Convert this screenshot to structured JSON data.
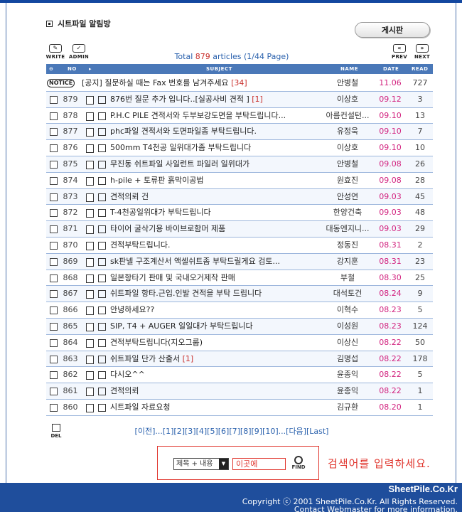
{
  "board": {
    "title": "시트파일 알림방",
    "tab_label": "게시판"
  },
  "toolbar": {
    "write": "WRITE",
    "admin": "ADMIN",
    "prev": "PREV",
    "next": "NEXT",
    "del": "DEL",
    "find": "FIND"
  },
  "total": {
    "prefix": "Total ",
    "count": "879",
    "suffix": " articles (1/44 Page)"
  },
  "columns": {
    "no": "NO",
    "subject": "SUBJECT",
    "name": "NAME",
    "date": "DATE",
    "read": "READ"
  },
  "notice": {
    "badge": "NOTICE",
    "subject": "[공지] 질문하실 때는 Fax 번호를 남겨주세요",
    "comments": "[34]",
    "name": "안병철",
    "date": "11.06",
    "read": "727"
  },
  "rows": [
    {
      "no": "879",
      "subject": "876번 질문 추가 입니다..[실공사비 견적 ]",
      "comments": "[1]",
      "name": "이상호",
      "date": "09.12",
      "read": "3"
    },
    {
      "no": "878",
      "subject": "P.H.C PILE 견적서와 두부보강도면을 부탁드립니다...",
      "comments": "",
      "name": "아름컨설턴...",
      "date": "09.10",
      "read": "13"
    },
    {
      "no": "877",
      "subject": "phc파일 견적서와 도면파일좀 부탁드립니다.",
      "comments": "",
      "name": "유정욱",
      "date": "09.10",
      "read": "7"
    },
    {
      "no": "876",
      "subject": "500mm T4천공 일위대가좀 부탁드립니다",
      "comments": "",
      "name": "이상호",
      "date": "09.10",
      "read": "10"
    },
    {
      "no": "875",
      "subject": "무진동 쉬트파일 사일런트 파일러 일위대가",
      "comments": "",
      "name": "안병철",
      "date": "09.08",
      "read": "26"
    },
    {
      "no": "874",
      "subject": "h-pile + 토류판 흙막이공법",
      "comments": "",
      "name": "원효진",
      "date": "09.08",
      "read": "28"
    },
    {
      "no": "873",
      "subject": "견적의뢰 건",
      "comments": "",
      "name": "안성연",
      "date": "09.03",
      "read": "45"
    },
    {
      "no": "872",
      "subject": "T-4천공일위대가 부탁드립니다",
      "comments": "",
      "name": "한양건축",
      "date": "09.03",
      "read": "48"
    },
    {
      "no": "871",
      "subject": "타이어 굴삭기용 바이브로함머 제품",
      "comments": "",
      "name": "대동엔지니...",
      "date": "09.03",
      "read": "29"
    },
    {
      "no": "870",
      "subject": "견적부탁드립니다.",
      "comments": "",
      "name": "정동진",
      "date": "08.31",
      "read": "2"
    },
    {
      "no": "869",
      "subject": "sk판넬 구조계산서 액셀쉬트좀 부탁드릴게요 검토...",
      "comments": "",
      "name": "강지훈",
      "date": "08.31",
      "read": "23"
    },
    {
      "no": "868",
      "subject": "일본항타기 판매 및 국내오거제작 판매",
      "comments": "",
      "name": "부철",
      "date": "08.30",
      "read": "25"
    },
    {
      "no": "867",
      "subject": "쉬트파일 항타.근입.인발 견적을 부탁 드립니다",
      "comments": "",
      "name": "대석토건",
      "date": "08.24",
      "read": "9"
    },
    {
      "no": "866",
      "subject": "안녕하세요??",
      "comments": "",
      "name": "이혁수",
      "date": "08.23",
      "read": "5"
    },
    {
      "no": "865",
      "subject": "SIP,  T4 + AUGER 일일대가 부탁드립니다",
      "comments": "",
      "name": "이성원",
      "date": "08.23",
      "read": "124"
    },
    {
      "no": "864",
      "subject": "견적부탁드립니다(지오그룹)",
      "comments": "",
      "name": "이상신",
      "date": "08.22",
      "read": "50"
    },
    {
      "no": "863",
      "subject": "쉬트파일 단가 산출서",
      "comments": "[1]",
      "name": "김명섭",
      "date": "08.22",
      "read": "178"
    },
    {
      "no": "862",
      "subject": "다시오^^",
      "comments": "",
      "name": "윤종익",
      "date": "08.22",
      "read": "5"
    },
    {
      "no": "861",
      "subject": "견적의뢰",
      "comments": "",
      "name": "윤종익",
      "date": "08.22",
      "read": "1"
    },
    {
      "no": "860",
      "subject": "시트파일 자료요청",
      "comments": "",
      "name": "김규환",
      "date": "08.20",
      "read": "1"
    }
  ],
  "pager": "[이전]...[1][2][3][4][5][6][7][8][9][10]...[다음][Last]",
  "search": {
    "field_select": "제목 + 내용",
    "input_value": "이곳에",
    "hint": "검색어를 입력하세요."
  },
  "footer": {
    "logo": "SheetPile.Co.Kr",
    "copyright": "Copyright ⓒ 2001 SheetPile.Co.Kr. All Rights Reserved.",
    "contact": "Contact Webmaster for more information."
  },
  "colors": {
    "accent_blue": "#1f4e9c",
    "date_pink": "#d2237f",
    "comment_red": "#c9302c",
    "search_red": "#e0342c"
  }
}
